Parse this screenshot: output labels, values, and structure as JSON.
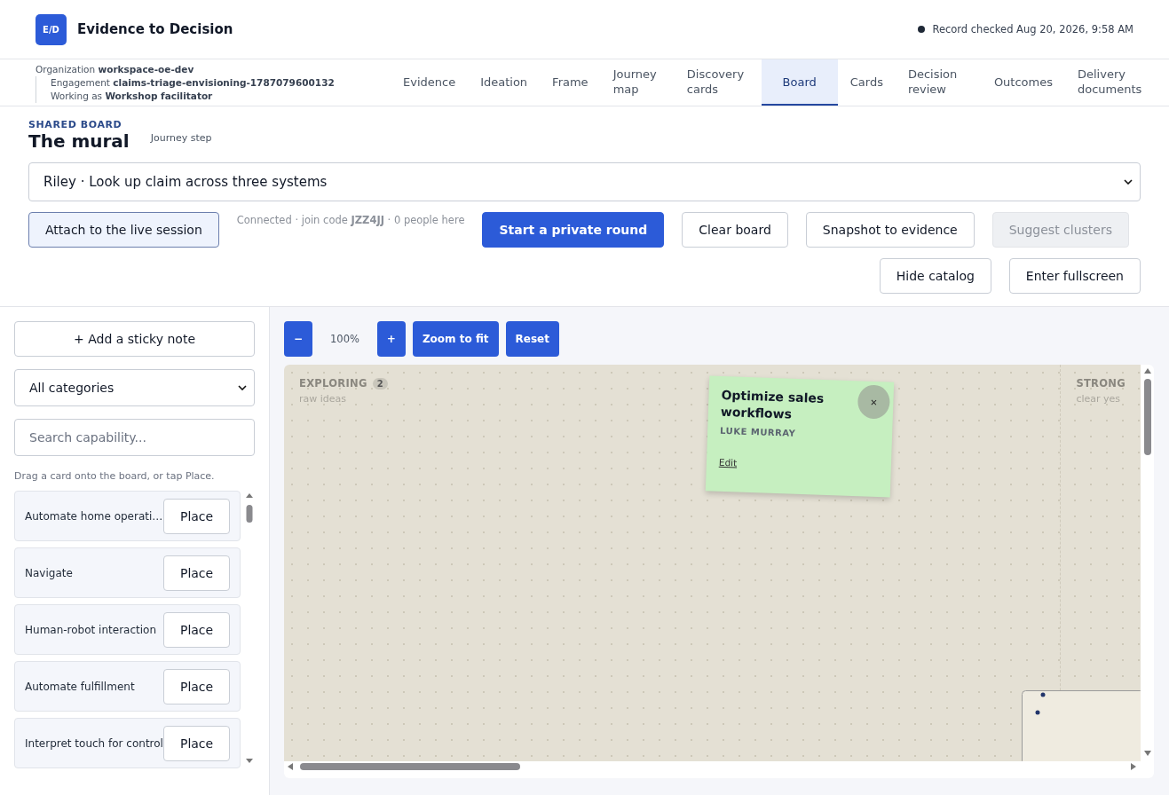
{
  "app": {
    "logo": "E/D",
    "title": "Evidence to Decision",
    "status": "Record checked Aug 20, 2026, 9:58 AM"
  },
  "context": [
    {
      "text": "Organization **workspace-oe-dev**"
    },
    {
      "text": "Engagement **claims-triage-envisioning-1787079600132**"
    },
    {
      "text": "Working as **Workshop facilitator**"
    }
  ],
  "tabs": [
    {
      "label": "Evidence",
      "selected": false
    },
    {
      "label": "Ideation",
      "selected": false
    },
    {
      "label": "Frame",
      "selected": false
    },
    {
      "label": "Journey map",
      "selected": false
    },
    {
      "label": "Discovery cards",
      "selected": false
    },
    {
      "label": "Board",
      "selected": true
    },
    {
      "label": "Cards",
      "selected": false
    },
    {
      "label": "Decision review",
      "selected": false
    },
    {
      "label": "Outcomes",
      "selected": false
    },
    {
      "label": "Delivery documents",
      "selected": false
    }
  ],
  "board_header": {
    "eyebrow": "SHARED BOARD",
    "title": "The mural",
    "subtitle": "Journey step"
  },
  "journey_select": {
    "value": "Riley · Look up claim across three systems"
  },
  "session": {
    "button": "Attach to the live session",
    "status": "Connected · join code **JZZ4JJ** · 0 people here"
  },
  "actions": [
    {
      "label": "Start a private round",
      "kind": "primary",
      "disabled": false
    },
    {
      "label": "Clear board",
      "kind": "secondary",
      "disabled": false
    },
    {
      "label": "Snapshot to evidence",
      "kind": "secondary",
      "disabled": false
    },
    {
      "label": "Suggest clusters",
      "kind": "secondary",
      "disabled": true
    }
  ],
  "view_actions": [
    {
      "label": "Hide catalog"
    },
    {
      "label": "Enter fullscreen"
    }
  ],
  "catalog": {
    "add_button": "+ Add a sticky note",
    "category": "All categories",
    "search_placeholder": "Search capability...",
    "hint": "Drag a card onto the board, or tap Place.",
    "items": [
      {
        "name": "Automate home operati…",
        "action": "Place"
      },
      {
        "name": "Navigate",
        "action": "Place"
      },
      {
        "name": "Human-robot interaction",
        "action": "Place"
      },
      {
        "name": "Automate fulfillment",
        "action": "Place"
      },
      {
        "name": "Interpret touch for control",
        "action": "Place"
      }
    ]
  },
  "zoom": {
    "out": "−",
    "level": "100%",
    "in": "+",
    "fit": "Zoom to fit",
    "reset": "Reset"
  },
  "lanes": [
    {
      "title": "EXPLORING",
      "count": "2",
      "subtitle": "raw ideas"
    },
    {
      "title": "STRONG",
      "subtitle": "clear yes"
    }
  ],
  "stickies": [
    {
      "title": "Optimize sales workflows",
      "author": "LUKE MURRAY",
      "edit": "Edit",
      "close": "×",
      "color": "#c6efc0"
    }
  ]
}
